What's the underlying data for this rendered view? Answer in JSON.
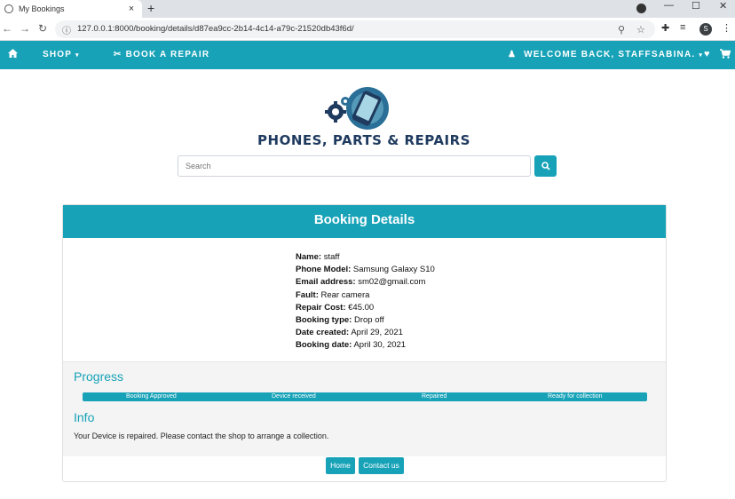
{
  "browser": {
    "tab_title": "My Bookings",
    "tab_close": "×",
    "new_tab": "+",
    "url": "127.0.0.1:8000/booking/details/d87ea9cc-2b14-4c14-a79c-21520db43f6d/",
    "profile_initial": "S"
  },
  "nav": {
    "home_icon": "home-icon",
    "shop_label": "SHOP",
    "book_repair_label": "BOOK A REPAIR",
    "welcome_label": "WELCOME BACK, STAFFSABINA."
  },
  "logo": {
    "text": "PHONES, PARTS & REPAIRS"
  },
  "search": {
    "placeholder": "Search"
  },
  "booking": {
    "header": "Booking Details",
    "fields": [
      {
        "label": "Name:",
        "value": "staff"
      },
      {
        "label": "Phone Model:",
        "value": "Samsung Galaxy S10"
      },
      {
        "label": "Email address:",
        "value": "sm02@gmail.com"
      },
      {
        "label": "Fault:",
        "value": "Rear camera"
      },
      {
        "label": "Repair Cost:",
        "value": "€45.00"
      },
      {
        "label": "Booking type:",
        "value": "Drop off"
      },
      {
        "label": "Date created:",
        "value": "April 29, 2021"
      },
      {
        "label": "Booking date:",
        "value": "April 30, 2021"
      }
    ]
  },
  "progress": {
    "title": "Progress",
    "steps": [
      "Booking Approved",
      "Device received",
      "Repaired",
      "Ready for collection"
    ]
  },
  "info": {
    "title": "Info",
    "text": "Your Device is repaired. Please contact the shop to arrange a collection."
  },
  "buttons": {
    "home": "Home",
    "contact": "Contact us"
  },
  "colors": {
    "accent": "#17a2b8",
    "logo_text": "#1f3a5f"
  }
}
